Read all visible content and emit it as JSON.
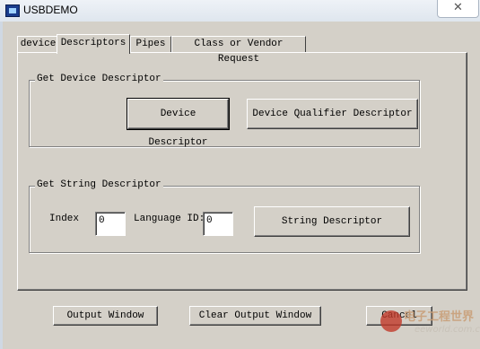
{
  "window": {
    "title": "USBDEMO",
    "close_glyph": "✕"
  },
  "tabs": [
    {
      "label": "device"
    },
    {
      "label": "Descriptors"
    },
    {
      "label": "Pipes"
    },
    {
      "label": "Class or Vendor Request"
    }
  ],
  "device_group": {
    "title": "Get Device Descriptor",
    "device_descriptor_button": "Device Descriptor",
    "qualifier_button": "Device Qualifier Descriptor"
  },
  "string_group": {
    "title": "Get String Descriptor",
    "index_label": "Index",
    "index_value": "0",
    "language_label": "Language ID:",
    "language_value": "0",
    "string_button": "String Descriptor"
  },
  "footer": {
    "output_window": "Output Window",
    "clear_output": "Clear Output Window",
    "cancel": "Cancel"
  },
  "watermark": {
    "text": "电子工程世界",
    "url": "eeworld.com.cn"
  }
}
